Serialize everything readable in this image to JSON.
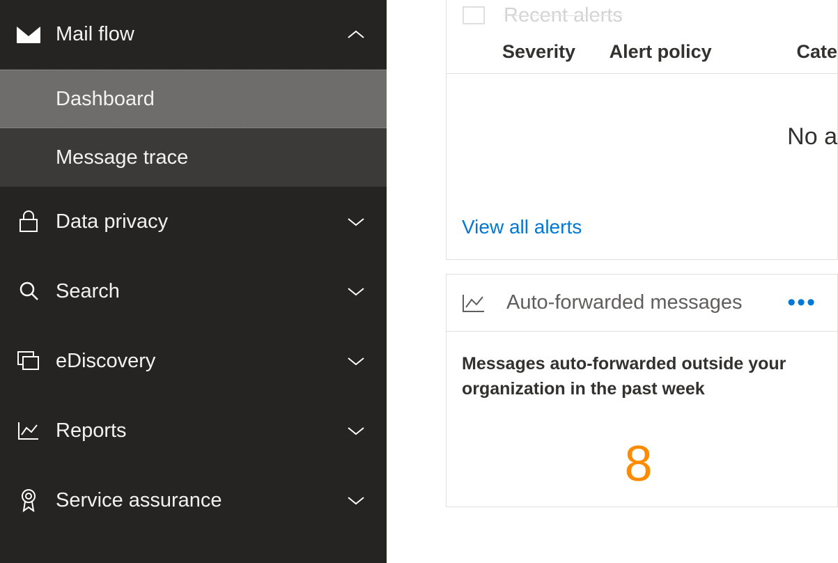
{
  "sidebar": {
    "mailflow": {
      "label": "Mail flow",
      "expanded": true,
      "children": [
        {
          "label": "Dashboard",
          "selected": true
        },
        {
          "label": "Message trace",
          "selected": false
        }
      ]
    },
    "items": [
      {
        "label": "Data privacy",
        "icon": "lock-icon"
      },
      {
        "label": "Search",
        "icon": "search-icon"
      },
      {
        "label": "eDiscovery",
        "icon": "ediscovery-icon"
      },
      {
        "label": "Reports",
        "icon": "reports-icon"
      },
      {
        "label": "Service assurance",
        "icon": "assurance-icon"
      }
    ]
  },
  "alerts": {
    "header_truncated": "Recent alerts",
    "columns": {
      "severity": "Severity",
      "policy": "Alert policy",
      "category": "Cate"
    },
    "empty_text": "No a",
    "view_all": "View all alerts"
  },
  "forwarded": {
    "title": "Auto-forwarded messages",
    "description": "Messages auto-forwarded outside your organization in the past week",
    "count": "8"
  }
}
